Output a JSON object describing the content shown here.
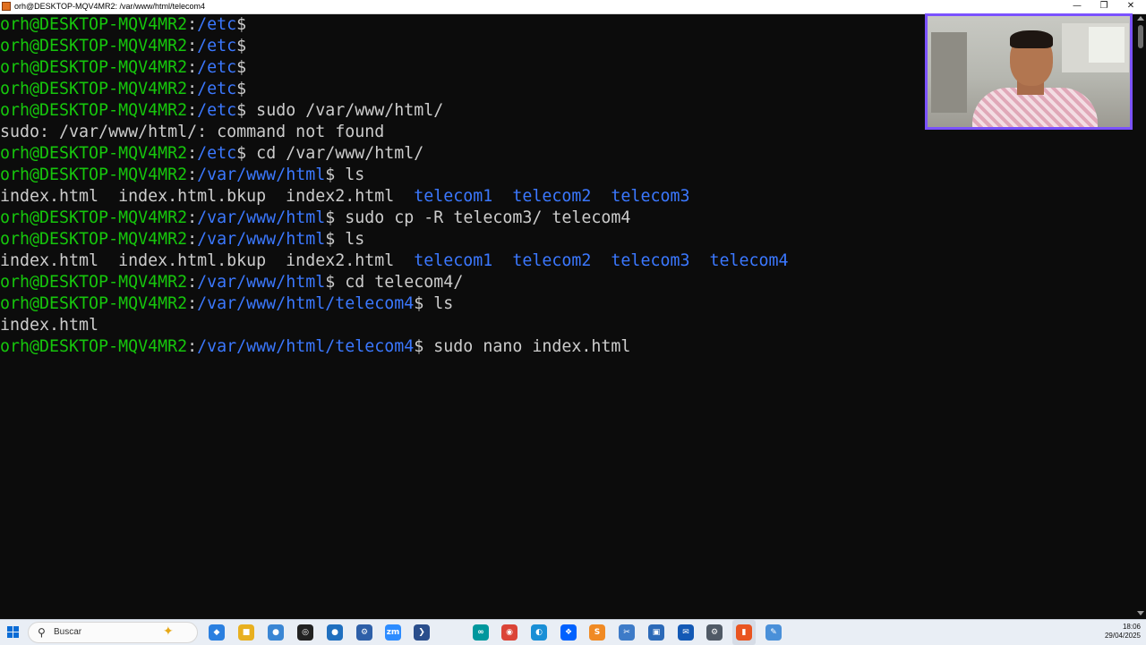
{
  "window": {
    "title": "orh@DESKTOP-MQV4MR2: /var/www/html/telecom4",
    "minimize": "—",
    "maximize": "❐",
    "close": "✕"
  },
  "colors": {
    "prompt_user": "#16c60c",
    "path": "#3b78ff",
    "text": "#cccccc",
    "background": "#0c0c0c"
  },
  "terminal": {
    "lines": [
      [
        {
          "t": "orh@DESKTOP-MQV4MR2",
          "c": "g"
        },
        {
          "t": ":",
          "c": "w"
        },
        {
          "t": "/etc",
          "c": "b"
        },
        {
          "t": "$",
          "c": "w"
        }
      ],
      [
        {
          "t": "orh@DESKTOP-MQV4MR2",
          "c": "g"
        },
        {
          "t": ":",
          "c": "w"
        },
        {
          "t": "/etc",
          "c": "b"
        },
        {
          "t": "$",
          "c": "w"
        }
      ],
      [
        {
          "t": "orh@DESKTOP-MQV4MR2",
          "c": "g"
        },
        {
          "t": ":",
          "c": "w"
        },
        {
          "t": "/etc",
          "c": "b"
        },
        {
          "t": "$",
          "c": "w"
        }
      ],
      [
        {
          "t": "orh@DESKTOP-MQV4MR2",
          "c": "g"
        },
        {
          "t": ":",
          "c": "w"
        },
        {
          "t": "/etc",
          "c": "b"
        },
        {
          "t": "$",
          "c": "w"
        }
      ],
      [
        {
          "t": "orh@DESKTOP-MQV4MR2",
          "c": "g"
        },
        {
          "t": ":",
          "c": "w"
        },
        {
          "t": "/etc",
          "c": "b"
        },
        {
          "t": "$ sudo /var/www/html/",
          "c": "w"
        }
      ],
      [
        {
          "t": "sudo: /var/www/html/: command not found",
          "c": "w"
        }
      ],
      [
        {
          "t": "orh@DESKTOP-MQV4MR2",
          "c": "g"
        },
        {
          "t": ":",
          "c": "w"
        },
        {
          "t": "/etc",
          "c": "b"
        },
        {
          "t": "$ cd /var/www/html/",
          "c": "w"
        }
      ],
      [
        {
          "t": "orh@DESKTOP-MQV4MR2",
          "c": "g"
        },
        {
          "t": ":",
          "c": "w"
        },
        {
          "t": "/var/www/html",
          "c": "b"
        },
        {
          "t": "$ ls",
          "c": "w"
        }
      ],
      [
        {
          "t": "index.html  index.html.bkup  index2.html  ",
          "c": "w"
        },
        {
          "t": "telecom1",
          "c": "b"
        },
        {
          "t": "  ",
          "c": "w"
        },
        {
          "t": "telecom2",
          "c": "b"
        },
        {
          "t": "  ",
          "c": "w"
        },
        {
          "t": "telecom3",
          "c": "b"
        }
      ],
      [
        {
          "t": "orh@DESKTOP-MQV4MR2",
          "c": "g"
        },
        {
          "t": ":",
          "c": "w"
        },
        {
          "t": "/var/www/html",
          "c": "b"
        },
        {
          "t": "$ sudo cp -R telecom3/ telecom4",
          "c": "w"
        }
      ],
      [
        {
          "t": "orh@DESKTOP-MQV4MR2",
          "c": "g"
        },
        {
          "t": ":",
          "c": "w"
        },
        {
          "t": "/var/www/html",
          "c": "b"
        },
        {
          "t": "$ ls",
          "c": "w"
        }
      ],
      [
        {
          "t": "index.html  index.html.bkup  index2.html  ",
          "c": "w"
        },
        {
          "t": "telecom1",
          "c": "b"
        },
        {
          "t": "  ",
          "c": "w"
        },
        {
          "t": "telecom2",
          "c": "b"
        },
        {
          "t": "  ",
          "c": "w"
        },
        {
          "t": "telecom3",
          "c": "b"
        },
        {
          "t": "  ",
          "c": "w"
        },
        {
          "t": "telecom4",
          "c": "b"
        }
      ],
      [
        {
          "t": "orh@DESKTOP-MQV4MR2",
          "c": "g"
        },
        {
          "t": ":",
          "c": "w"
        },
        {
          "t": "/var/www/html",
          "c": "b"
        },
        {
          "t": "$ cd telecom4/",
          "c": "w"
        }
      ],
      [
        {
          "t": "orh@DESKTOP-MQV4MR2",
          "c": "g"
        },
        {
          "t": ":",
          "c": "w"
        },
        {
          "t": "/var/www/html/telecom4",
          "c": "b"
        },
        {
          "t": "$ ls",
          "c": "w"
        }
      ],
      [
        {
          "t": "index.html",
          "c": "w"
        }
      ],
      [
        {
          "t": "orh@DESKTOP-MQV4MR2",
          "c": "g"
        },
        {
          "t": ":",
          "c": "w"
        },
        {
          "t": "/var/www/html/telecom4",
          "c": "b"
        },
        {
          "t": "$ sudo nano index.html",
          "c": "w"
        }
      ]
    ]
  },
  "taskbar": {
    "search_placeholder": "Buscar",
    "icons": [
      {
        "name": "copilot-icon",
        "glyph": "◆",
        "color": "#2a7fe0"
      },
      {
        "name": "file-explorer-icon",
        "glyph": "■",
        "color": "#e8b020"
      },
      {
        "name": "paint-icon",
        "glyph": "●",
        "color": "#3a86d4"
      },
      {
        "name": "chatgpt-icon",
        "glyph": "◎",
        "color": "#222222"
      },
      {
        "name": "network-icon",
        "glyph": "●",
        "color": "#1f6fbf"
      },
      {
        "name": "tools-icon",
        "glyph": "⚙",
        "color": "#2d5fa8"
      },
      {
        "name": "zoom-icon",
        "glyph": "zm",
        "color": "#2d8cff"
      },
      {
        "name": "powershell-icon",
        "glyph": "❯",
        "color": "#2a4e8c"
      },
      {
        "name": "arduino-icon",
        "glyph": "∞",
        "color": "#00979d"
      },
      {
        "name": "chrome-icon",
        "glyph": "◉",
        "color": "#db4437"
      },
      {
        "name": "edge-icon",
        "glyph": "◐",
        "color": "#1a8fd6"
      },
      {
        "name": "dropbox-icon",
        "glyph": "❖",
        "color": "#0061fe"
      },
      {
        "name": "sublime-text-icon",
        "glyph": "S",
        "color": "#f08a24"
      },
      {
        "name": "snipping-tool-icon",
        "glyph": "✂",
        "color": "#3d7bc8"
      },
      {
        "name": "vm-icon",
        "glyph": "▣",
        "color": "#2c6ab8"
      },
      {
        "name": "outlook-icon",
        "glyph": "✉",
        "color": "#1359b5"
      },
      {
        "name": "settings-icon",
        "glyph": "⚙",
        "color": "#505a66"
      },
      {
        "name": "ubuntu-terminal-icon",
        "glyph": "▮",
        "color": "#e95420"
      },
      {
        "name": "notepad-icon",
        "glyph": "✎",
        "color": "#4a90d9"
      }
    ],
    "clock_time": "18:06",
    "clock_date": "29/04/2025"
  }
}
